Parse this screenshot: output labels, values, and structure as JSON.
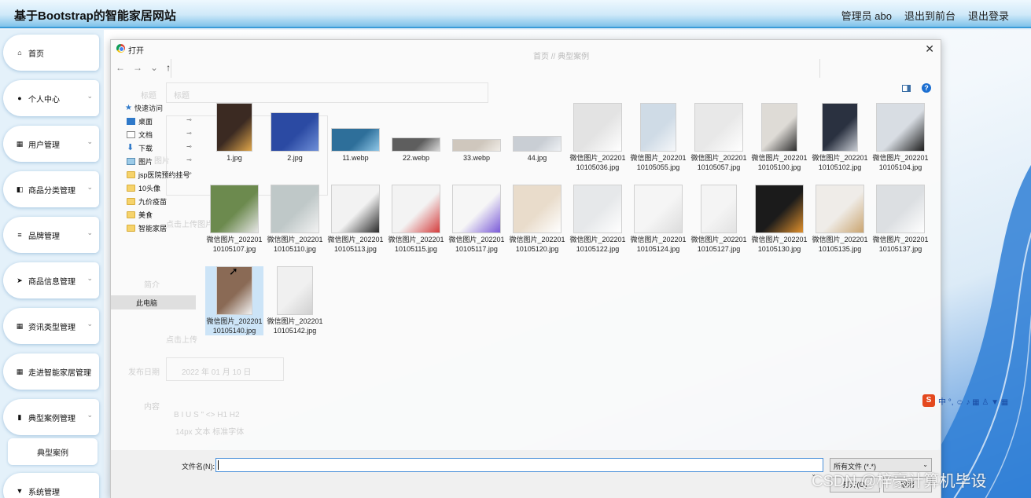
{
  "app": {
    "title": "基于Bootstrap的智能家居网站",
    "nav": {
      "admin": "管理员 abo",
      "front": "退出到前台",
      "logout": "退出登录"
    }
  },
  "sidebar": {
    "items": [
      {
        "label": "首页",
        "icon": "home-icon",
        "chevron": false
      },
      {
        "label": "个人中心",
        "icon": "user-icon",
        "chevron": true
      },
      {
        "label": "用户管理",
        "icon": "grid-icon",
        "chevron": true
      },
      {
        "label": "商品分类管理",
        "icon": "thumb-icon",
        "chevron": true
      },
      {
        "label": "品牌管理",
        "icon": "list-icon",
        "chevron": true
      },
      {
        "label": "商品信息管理",
        "icon": "send-icon",
        "chevron": true
      },
      {
        "label": "资讯类型管理",
        "icon": "grid-icon",
        "chevron": true
      },
      {
        "label": "走进智能家居管理",
        "icon": "grid-icon",
        "chevron": true
      },
      {
        "label": "典型案例管理",
        "icon": "bar-chart-icon",
        "chevron": true
      }
    ],
    "sub_item": "典型案例",
    "last_item": {
      "label": "系统管理",
      "icon": "shield-icon"
    }
  },
  "ghost_form": {
    "breadcrumb": "首页 // 典型案例",
    "title_label": "标题",
    "title_placeholder": "标题",
    "image_label": "图片",
    "upload_hint1": "点击上传图片",
    "summary_label": "简介",
    "upload_hint2": "点击上传",
    "date_label": "发布日期",
    "date_value": "2022 年 01 月 10 日",
    "content_label": "内容",
    "toolbar1": "B I U S \" <> H1 H2",
    "toolbar2": "14px 文本 标准字体"
  },
  "dialog": {
    "title": "打开",
    "close": "✕",
    "nav": {
      "back": "←",
      "forward": "→",
      "down": "⌄",
      "up": "↑"
    },
    "nav_pane": {
      "quick_access": "快速访问",
      "items": [
        {
          "label": "桌面",
          "type": "desk",
          "pin": true
        },
        {
          "label": "文档",
          "type": "doc",
          "pin": true
        },
        {
          "label": "下载",
          "type": "dl",
          "pin": true
        },
        {
          "label": "图片",
          "type": "pic",
          "pin": true
        },
        {
          "label": "jsp医院预约挂号",
          "type": "folder",
          "pin": true
        },
        {
          "label": "10头像",
          "type": "folder",
          "pin": false
        },
        {
          "label": "九价疫苗",
          "type": "folder",
          "pin": false
        },
        {
          "label": "美食",
          "type": "folder",
          "pin": false
        },
        {
          "label": "智能家居",
          "type": "folder",
          "pin": false
        }
      ],
      "this_pc": "此电脑"
    },
    "files": [
      {
        "name": "1.jpg",
        "color": "#3b2a22",
        "accent": "#e0a64a",
        "w": 46,
        "h": 62,
        "sel": false
      },
      {
        "name": "2.jpg",
        "color": "#2b4aa3",
        "accent": "#6f8fd8",
        "w": 62,
        "h": 50,
        "sel": false
      },
      {
        "name": "11.webp",
        "color": "#2e6f9a",
        "accent": "#8fc7e8",
        "w": 62,
        "h": 30,
        "sel": false
      },
      {
        "name": "22.webp",
        "color": "#5e5e5e",
        "accent": "#d9d9d9",
        "w": 62,
        "h": 18,
        "sel": false
      },
      {
        "name": "33.webp",
        "color": "#cfc7bd",
        "accent": "#f0ece6",
        "w": 62,
        "h": 16,
        "sel": false
      },
      {
        "name": "44.jpg",
        "color": "#c9ced4",
        "accent": "#eef1f4",
        "w": 62,
        "h": 20,
        "sel": false
      },
      {
        "name": "微信图片_20220110105036.jpg",
        "color": "#e3e3e3",
        "accent": "#ffffff",
        "w": 62,
        "h": 62,
        "sel": false
      },
      {
        "name": "微信图片_20220110105055.jpg",
        "color": "#cfdbe6",
        "accent": "#f5f7f9",
        "w": 46,
        "h": 62,
        "sel": false
      },
      {
        "name": "微信图片_20220110105057.jpg",
        "color": "#e8e8e8",
        "accent": "#ffffff",
        "w": 62,
        "h": 62,
        "sel": false
      },
      {
        "name": "微信图片_20220110105100.jpg",
        "color": "#dedbd6",
        "accent": "#2d2d2d",
        "w": 46,
        "h": 62,
        "sel": false
      },
      {
        "name": "微信图片_20220110105102.jpg",
        "color": "#2a3140",
        "accent": "#c9cdd4",
        "w": 46,
        "h": 62,
        "sel": false
      },
      {
        "name": "微信图片_20220110105104.jpg",
        "color": "#d8dde3",
        "accent": "#1c1c1c",
        "w": 62,
        "h": 62,
        "sel": false
      },
      {
        "name": "微信图片_20220110105107.jpg",
        "color": "#6c8a4e",
        "accent": "#e6e6e6",
        "w": 62,
        "h": 62,
        "sel": false
      },
      {
        "name": "微信图片_20220110105110.jpg",
        "color": "#bfc8c8",
        "accent": "#f2f2f2",
        "w": 62,
        "h": 62,
        "sel": false
      },
      {
        "name": "微信图片_20220110105113.jpg",
        "color": "#f2f2f2",
        "accent": "#2a2a2a",
        "w": 62,
        "h": 62,
        "sel": false
      },
      {
        "name": "微信图片_20220110105115.jpg",
        "color": "#f3f3f3",
        "accent": "#d43c3c",
        "w": 62,
        "h": 62,
        "sel": false
      },
      {
        "name": "微信图片_20220110105117.jpg",
        "color": "#f6f6f6",
        "accent": "#7a5ad8",
        "w": 62,
        "h": 62,
        "sel": false
      },
      {
        "name": "微信图片_20220110105120.jpg",
        "color": "#e9dccb",
        "accent": "#ffffff",
        "w": 62,
        "h": 62,
        "sel": false
      },
      {
        "name": "微信图片_20220110105122.jpg",
        "color": "#e6e8ea",
        "accent": "#ffffff",
        "w": 62,
        "h": 62,
        "sel": false
      },
      {
        "name": "微信图片_20220110105124.jpg",
        "color": "#f5f5f5",
        "accent": "#dcdcdc",
        "w": 62,
        "h": 62,
        "sel": false
      },
      {
        "name": "微信图片_20220110105127.jpg",
        "color": "#f4f4f4",
        "accent": "#e2e2e2",
        "w": 46,
        "h": 62,
        "sel": false
      },
      {
        "name": "微信图片_20220110105130.jpg",
        "color": "#1b1b1b",
        "accent": "#e0902c",
        "w": 62,
        "h": 62,
        "sel": false
      },
      {
        "name": "微信图片_20220110105135.jpg",
        "color": "#efece8",
        "accent": "#caa46f",
        "w": 62,
        "h": 62,
        "sel": false
      },
      {
        "name": "微信图片_20220110105137.jpg",
        "color": "#dcdfe2",
        "accent": "#ffffff",
        "w": 62,
        "h": 62,
        "sel": false
      },
      {
        "name": "微信图片_20220110105140.jpg",
        "color": "#8a6a55",
        "accent": "#f2f2f2",
        "w": 46,
        "h": 62,
        "sel": true
      },
      {
        "name": "微信图片_20220110105142.jpg",
        "color": "#f0f0f0",
        "accent": "#d0d0d0",
        "w": 46,
        "h": 62,
        "sel": false
      }
    ],
    "filename_label": "文件名(N):",
    "filename_value": "",
    "filetype": "所有文件 (*.*)",
    "open_button": "打开(O)",
    "cancel_button": "取消"
  },
  "ime_bar": "中 °, ☺ ♪ ▦ ♙ ▼ ▦",
  "watermark": "CSDN @梓豪计算机毕设",
  "colors": {
    "header_blue": "#3a9bd8",
    "accent": "#4a90d9",
    "selected": "#cce4f7"
  }
}
